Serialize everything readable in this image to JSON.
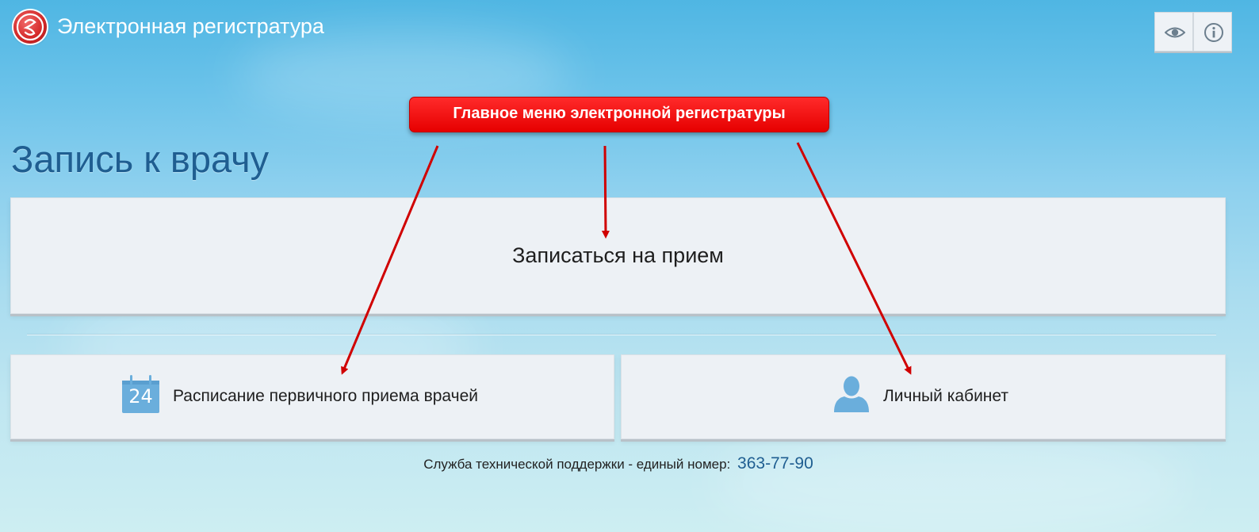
{
  "header": {
    "app_title": "Электронная регистратура",
    "logo_icon": "emblem-logo-icon",
    "buttons": [
      {
        "icon": "eye-icon",
        "purpose": "accessibility"
      },
      {
        "icon": "info-icon",
        "purpose": "info"
      }
    ]
  },
  "page": {
    "title": "Запись к врачу"
  },
  "menu": {
    "main_action": "Записаться на прием",
    "schedule": {
      "label": "Расписание первичного приема врачей",
      "icon": "calendar-icon",
      "calendar_day": "24"
    },
    "cabinet": {
      "label": "Личный кабинет",
      "icon": "user-icon"
    }
  },
  "footer": {
    "support_text": "Служба технической поддержки - единый номер:",
    "support_number": "363-77-90"
  },
  "annotation": {
    "callout_text": "Главное меню электронной регистратуры",
    "color": "#e60000"
  },
  "colors": {
    "title_blue": "#1f5e91",
    "card_bg": "#edf1f5",
    "icon_blue": "#6aaedc",
    "logo_red": "#d42a2a"
  }
}
